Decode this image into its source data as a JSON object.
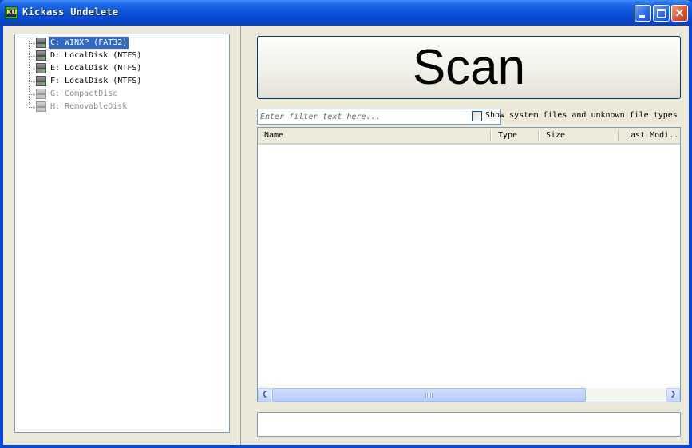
{
  "window": {
    "title": "Kickass Undelete",
    "icon_text": "KU"
  },
  "tree": {
    "items": [
      {
        "label": "C: WINXP (FAT32)",
        "selected": true,
        "enabled": true
      },
      {
        "label": "D: LocalDisk (NTFS)",
        "selected": false,
        "enabled": true
      },
      {
        "label": "E: LocalDisk (NTFS)",
        "selected": false,
        "enabled": true
      },
      {
        "label": "F: LocalDisk (NTFS)",
        "selected": false,
        "enabled": true
      },
      {
        "label": "G: CompactDisc",
        "selected": false,
        "enabled": false
      },
      {
        "label": "H: RemovableDisk",
        "selected": false,
        "enabled": false
      }
    ]
  },
  "scan": {
    "label": "Scan"
  },
  "filter": {
    "placeholder": "Enter filter text here...",
    "value": ""
  },
  "show_system": {
    "label": "Show system files and unknown file types",
    "checked": false
  },
  "file_list": {
    "columns": [
      "Name",
      "Type",
      "Size",
      "Last Modi.."
    ],
    "rows": []
  },
  "status": {
    "text": ""
  },
  "colors": {
    "titlebar": "#0A54DA",
    "selection": "#316AC5",
    "face": "#ECE9D8"
  }
}
